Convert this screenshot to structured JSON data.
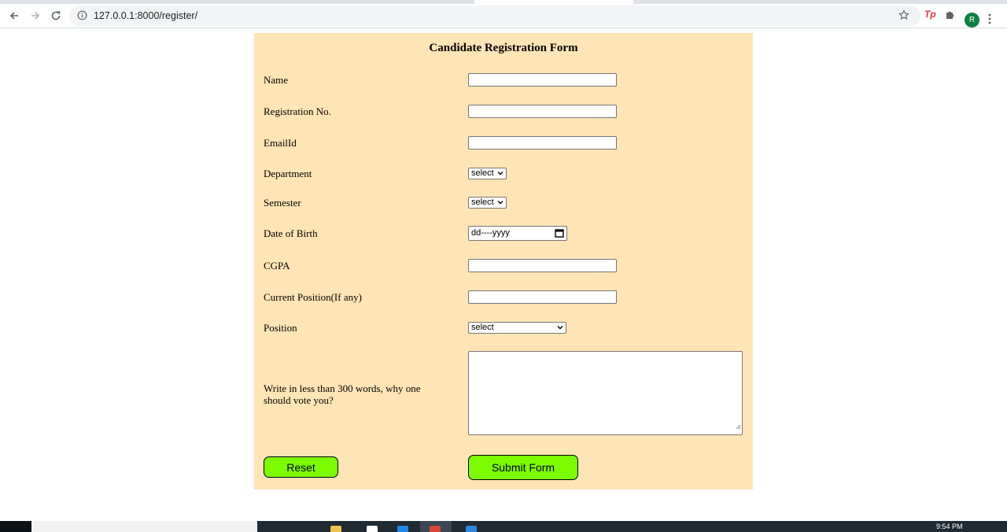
{
  "browser": {
    "url": "127.0.0.1:8000/register/",
    "avatar_letter": "R",
    "extension_tp": "Tp"
  },
  "form": {
    "title": "Candidate Registration Form",
    "fields": {
      "name_label": "Name",
      "regno_label": "Registration No.",
      "email_label": "EmailId",
      "department_label": "Department",
      "department_value": "select",
      "semester_label": "Semester",
      "semester_value": "select",
      "dob_label": "Date of Birth",
      "dob_placeholder": "dd----yyyy",
      "cgpa_label": "CGPA",
      "current_position_label": "Current Position(If any)",
      "position_label": "Position",
      "position_value": "select",
      "essay_label": "Write in less than 300 words, why one should vote you?"
    },
    "buttons": {
      "reset": "Reset",
      "submit": "Submit Form"
    },
    "colors": {
      "panel_bg": "#ffe4b5",
      "button_bg": "#7cfc00"
    }
  },
  "taskbar": {
    "clock": "9:54 PM"
  }
}
